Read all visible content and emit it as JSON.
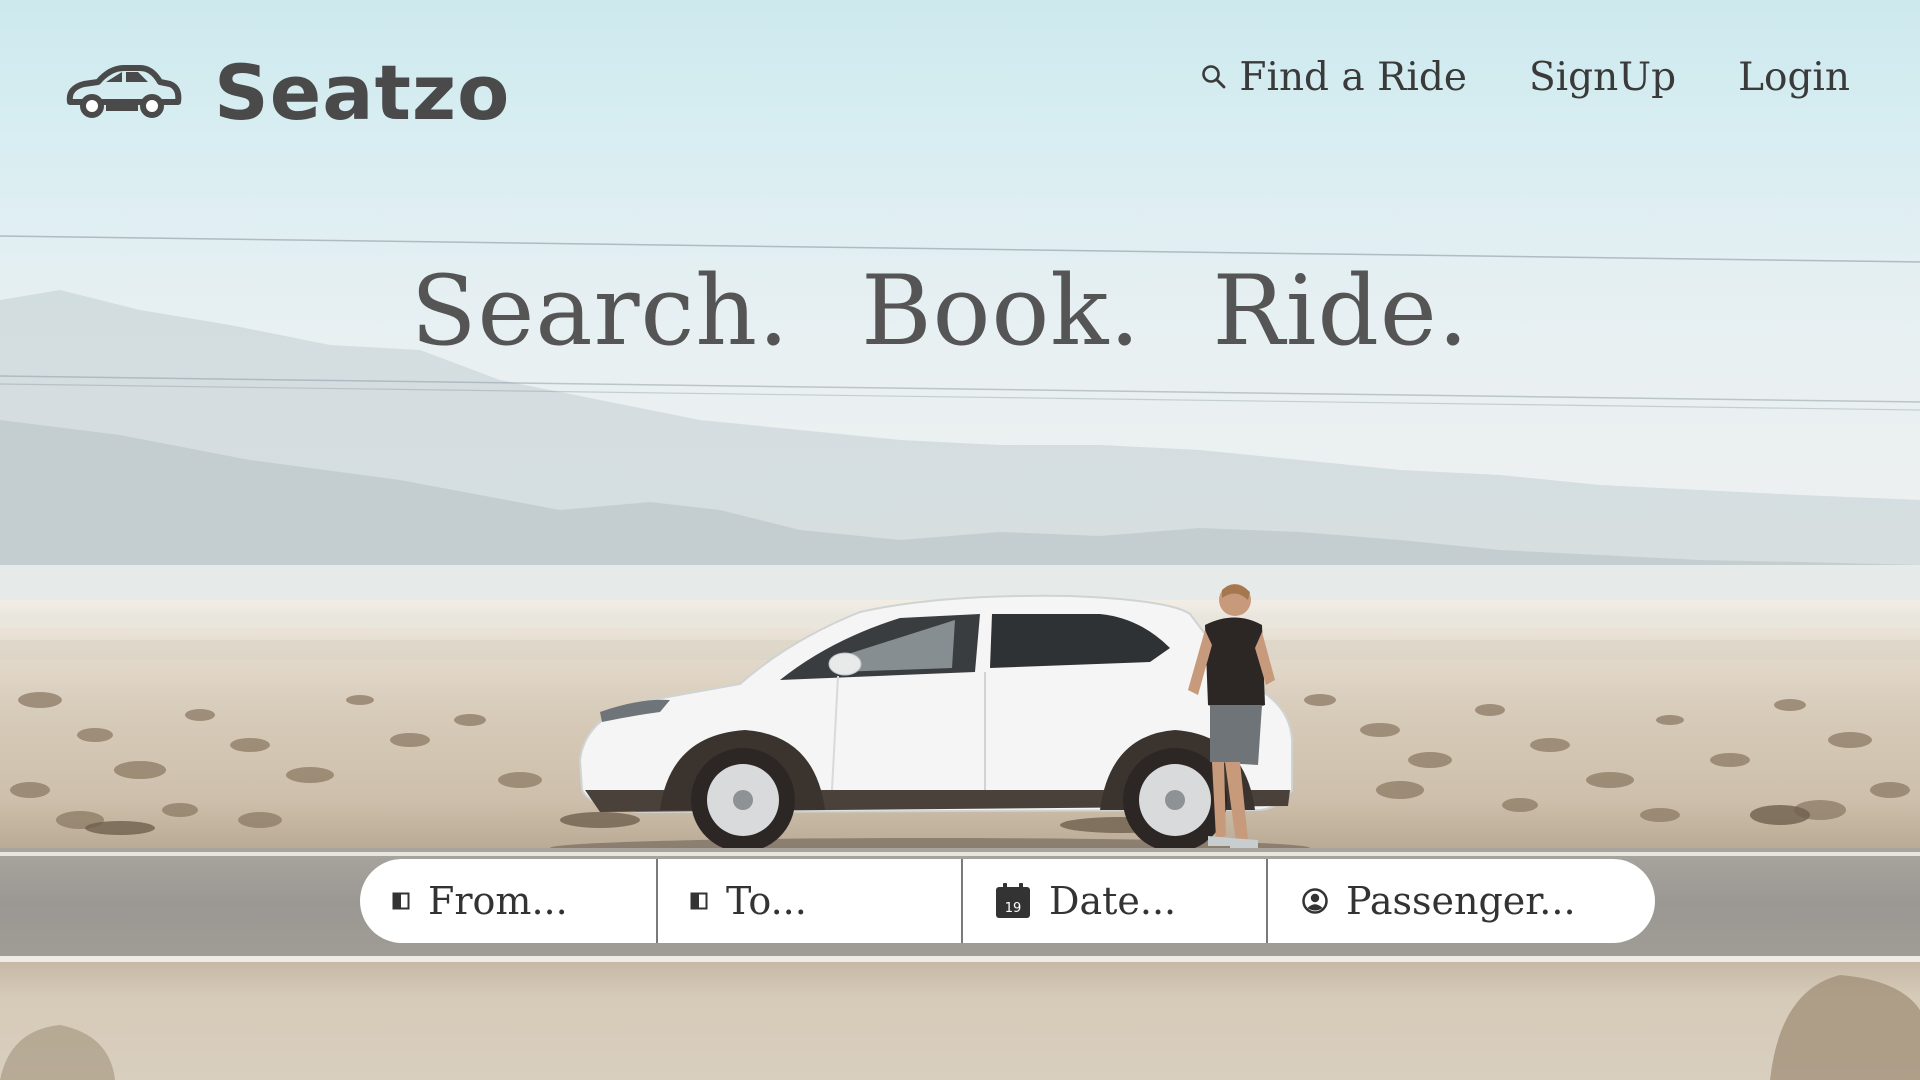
{
  "brand": {
    "name": "Seatzo",
    "logo_icon": "car-icon"
  },
  "nav": {
    "find_ride": "Find a Ride",
    "find_ride_icon": "search-icon",
    "signup": "SignUp",
    "login": "Login"
  },
  "hero": {
    "title": "Search. Book. Ride."
  },
  "search": {
    "from_placeholder": "From...",
    "to_placeholder": "To...",
    "date_placeholder": "Date...",
    "date_icon_day": "19",
    "passenger_placeholder": "Passenger..."
  },
  "colors": {
    "text_dark": "#4a4a4a",
    "search_bg": "#ffffff"
  }
}
